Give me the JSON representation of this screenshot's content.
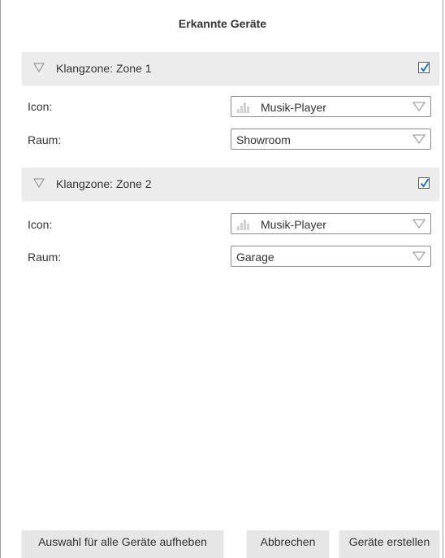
{
  "dialog": {
    "title": "Erkannte Geräte"
  },
  "zones": [
    {
      "header": "Klangzone: Zone 1",
      "checked": true,
      "icon_label": "Icon:",
      "icon_value": "Musik-Player",
      "room_label": "Raum:",
      "room_value": "Showroom"
    },
    {
      "header": "Klangzone: Zone 2",
      "checked": true,
      "icon_label": "Icon:",
      "icon_value": "Musik-Player",
      "room_label": "Raum:",
      "room_value": "Garage"
    }
  ],
  "footer": {
    "deselect_label": "Auswahl für alle Geräte aufheben",
    "cancel_label": "Abbrechen",
    "create_label": "Geräte erstellen"
  },
  "colors": {
    "checkbox_accent": "#1a6fd1",
    "header_bg": "#ececec",
    "button_bg": "#e6e6e6"
  }
}
